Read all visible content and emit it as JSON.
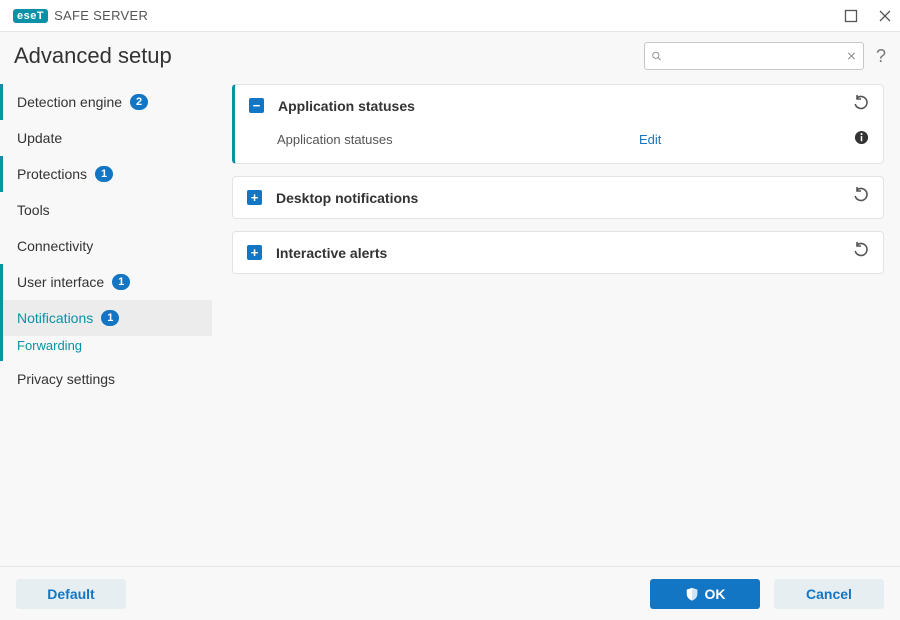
{
  "window": {
    "brand_badge": "eseT",
    "brand_text": "SAFE SERVER"
  },
  "header": {
    "title": "Advanced setup",
    "search_placeholder": ""
  },
  "sidebar": {
    "items": [
      {
        "label": "Detection engine",
        "badge": "2",
        "accent": true
      },
      {
        "label": "Update"
      },
      {
        "label": "Protections",
        "badge": "1",
        "accent": true
      },
      {
        "label": "Tools"
      },
      {
        "label": "Connectivity"
      },
      {
        "label": "User interface",
        "badge": "1",
        "accent": true
      },
      {
        "label": "Notifications",
        "badge": "1",
        "selected": true,
        "sub": [
          "Forwarding"
        ]
      },
      {
        "label": "Privacy settings"
      }
    ]
  },
  "panels": [
    {
      "title": "Application statuses",
      "expanded": true,
      "rows": [
        {
          "label": "Application statuses",
          "action": "Edit"
        }
      ]
    },
    {
      "title": "Desktop notifications",
      "expanded": false
    },
    {
      "title": "Interactive alerts",
      "expanded": false
    }
  ],
  "footer": {
    "default": "Default",
    "ok": "OK",
    "cancel": "Cancel"
  }
}
